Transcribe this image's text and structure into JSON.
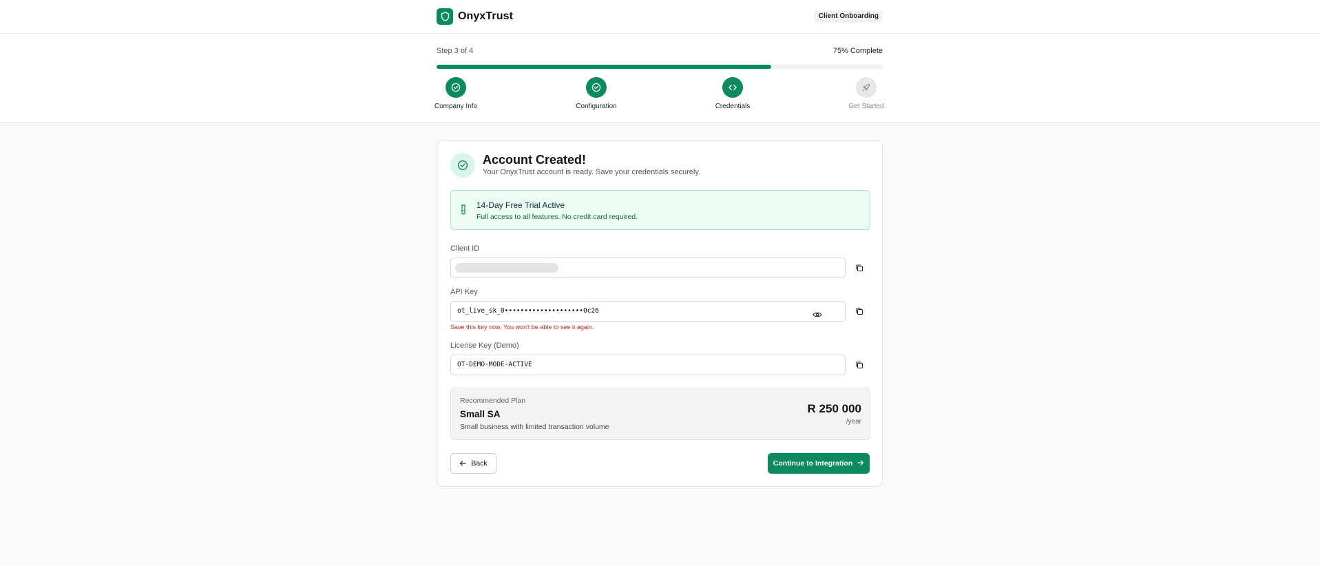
{
  "colors": {
    "accent": "#0c8a5f",
    "accent_soft": "#dcf5ea",
    "trial_bg": "#ecfbf3",
    "warning": "#c62828"
  },
  "header": {
    "brand_name": "OnyxTrust",
    "brand_icon": "shield-icon",
    "badge": "Client Onboarding"
  },
  "progress": {
    "step_text": "Step 3 of 4",
    "percent_text": "75% Complete",
    "fraction": 0.75,
    "steps": [
      {
        "label": "Company Info",
        "icon": "check-circle-icon",
        "status": "complete"
      },
      {
        "label": "Configuration",
        "icon": "check-circle-icon",
        "status": "complete"
      },
      {
        "label": "Credentials",
        "icon": "code-icon",
        "status": "current"
      },
      {
        "label": "Get Started",
        "icon": "rocket-icon",
        "status": "upcoming"
      }
    ]
  },
  "card": {
    "title": "Account Created!",
    "subtitle": "Your OnyxTrust account is ready. Save your credentials securely.",
    "trial": {
      "title": "14-Day Free Trial Active",
      "subtitle": "Full access to all features. No credit card required."
    },
    "fields": {
      "client_id": {
        "label": "Client ID",
        "value": ""
      },
      "api_key": {
        "label": "API Key",
        "value": "ot_live_sk_0••••••••••••••••••••0c26",
        "warning": "Save this key now. You won't be able to see it again."
      },
      "license_key": {
        "label": "License Key (Demo)",
        "value": "OT-DEMO-MODE-ACTIVE"
      }
    },
    "plan": {
      "eyebrow": "Recommended Plan",
      "name": "Small SA",
      "description": "Small business with limited transaction volume",
      "price": "R 250 000",
      "period": "/year"
    },
    "back_label": "Back",
    "continue_label": "Continue to Integration"
  }
}
